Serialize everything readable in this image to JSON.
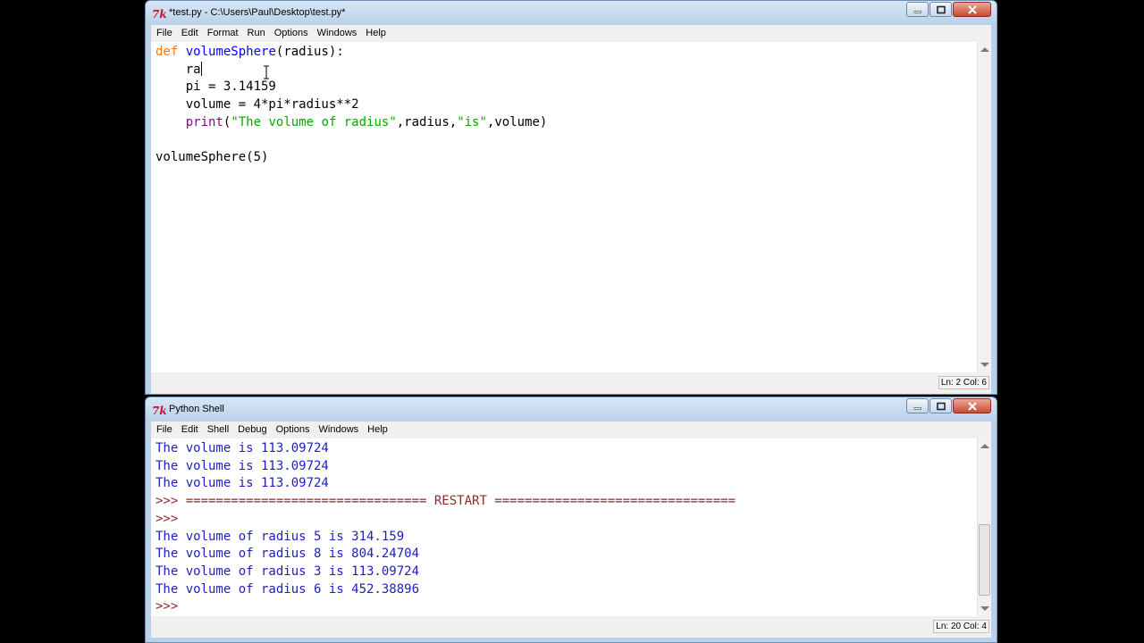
{
  "editor": {
    "title": "*test.py - C:\\Users\\Paul\\Desktop\\test.py*",
    "menu": [
      "File",
      "Edit",
      "Format",
      "Run",
      "Options",
      "Windows",
      "Help"
    ],
    "code": {
      "line1_kw": "def",
      "line1_fn": "volumeSphere",
      "line1_rest": "(radius):",
      "line2": "    ra",
      "line3": "    pi = 3.14159",
      "line4": "    volume = 4*pi*radius**2",
      "line5_indent": "    ",
      "line5_builtin": "print",
      "line5_p1": "(",
      "line5_str1": "\"The volume of radius\"",
      "line5_p2": ",radius,",
      "line5_str2": "\"is\"",
      "line5_p3": ",volume)",
      "line7": "volumeSphere(5)"
    },
    "status": "Ln: 2  Col: 6"
  },
  "shell": {
    "title": "Python Shell",
    "menu": [
      "File",
      "Edit",
      "Shell",
      "Debug",
      "Options",
      "Windows",
      "Help"
    ],
    "output": [
      "The volume is 113.09724",
      "The volume is 113.09724",
      "The volume is 113.09724"
    ],
    "restart_prompt": ">>> ",
    "restart_line": "================================ RESTART ================================",
    "prompt1": ">>>",
    "results": [
      "The volume of radius 5 is 314.159",
      "The volume of radius 8 is 804.24704",
      "The volume of radius 3 is 113.09724",
      "The volume of radius 6 is 452.38896"
    ],
    "prompt2": ">>>",
    "status": "Ln: 20  Col: 4"
  },
  "colors": {
    "keyword": "#ff7700",
    "builtin": "#900090",
    "definition": "#0000ff",
    "string": "#00aa00",
    "output": "#1e1ebf",
    "prompt": "#902a2a"
  }
}
